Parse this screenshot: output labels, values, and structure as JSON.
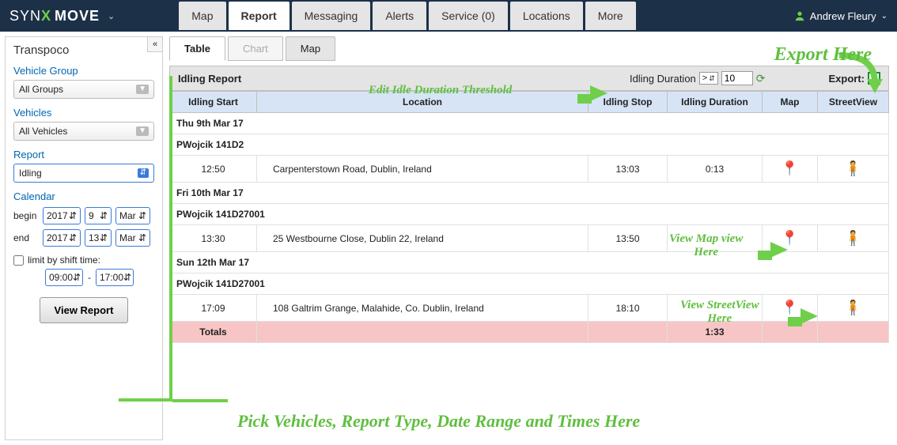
{
  "header": {
    "logo_left": "SYN",
    "logo_right": "MOVE",
    "tabs": [
      "Map",
      "Report",
      "Messaging",
      "Alerts",
      "Service (0)",
      "Locations",
      "More"
    ],
    "active_tab": "Report",
    "user": "Andrew Fleury"
  },
  "sidebar": {
    "title": "Transpoco",
    "group_label": "Vehicle Group",
    "group_value": "All Groups",
    "vehicles_label": "Vehicles",
    "vehicles_value": "All Vehicles",
    "report_label": "Report",
    "report_value": "Idling",
    "calendar_label": "Calendar",
    "begin_label": "begin",
    "begin_year": "2017",
    "begin_day": "9",
    "begin_month": "Mar",
    "end_label": "end",
    "end_year": "2017",
    "end_day": "13",
    "end_month": "Mar",
    "limit_label": "limit by shift time:",
    "time_from": "09:00",
    "time_sep": "-",
    "time_to": "17:00",
    "view_button": "View Report"
  },
  "subtabs": {
    "table": "Table",
    "chart": "Chart",
    "map": "Map"
  },
  "panel": {
    "title": "Idling Report",
    "duration_label": "Idling Duration",
    "duration_op": ">",
    "duration_value": "10",
    "export_label": "Export:"
  },
  "columns": [
    "Idling Start",
    "Location",
    "Idling Stop",
    "Idling Duration",
    "Map",
    "StreetView"
  ],
  "rows": [
    {
      "type": "date",
      "text": "Thu 9th Mar 17"
    },
    {
      "type": "vehicle",
      "text": "PWojcik 141D2"
    },
    {
      "type": "data",
      "start": "12:50",
      "loc": "Carpenterstown Road, Dublin, Ireland",
      "stop": "13:03",
      "dur": "0:13"
    },
    {
      "type": "date",
      "text": "Fri 10th Mar 17"
    },
    {
      "type": "vehicle",
      "text": "PWojcik 141D27001"
    },
    {
      "type": "data",
      "start": "13:30",
      "loc": "25 Westbourne Close, Dublin 22, Ireland",
      "stop": "13:50",
      "dur": ""
    },
    {
      "type": "date",
      "text": "Sun 12th Mar 17"
    },
    {
      "type": "vehicle",
      "text": "PWojcik 141D27001"
    },
    {
      "type": "data",
      "start": "17:09",
      "loc": "108 Galtrim Grange, Malahide, Co. Dublin, Ireland",
      "stop": "18:10",
      "dur": ""
    }
  ],
  "totals": {
    "label": "Totals",
    "value": "1:33"
  },
  "annotations": {
    "export": "Export Here",
    "threshold": "Edit Idle Duration Threshold",
    "mapview_l1": "View Map view",
    "mapview_l2": "Here",
    "streetview_l1": "View StreetView",
    "streetview_l2": "Here",
    "main": "Pick Vehicles, Report Type, Date Range and Times Here"
  }
}
